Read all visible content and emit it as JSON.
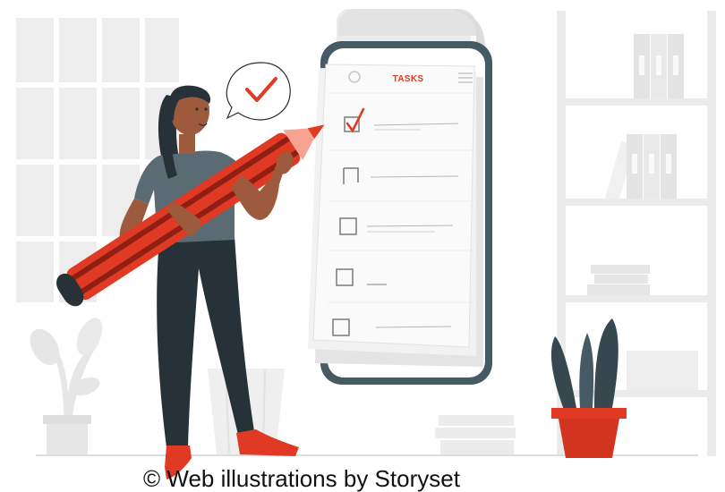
{
  "app": {
    "title": "TASKS",
    "credit": "© Web illustrations by Storyset"
  },
  "checklist": {
    "items": [
      {
        "checked": true
      },
      {
        "checked": false
      },
      {
        "checked": false
      },
      {
        "checked": false
      },
      {
        "checked": false
      }
    ]
  },
  "colors": {
    "accent": "#e03a25",
    "phone_frame": "#455a64",
    "skin": "#9e5a3c",
    "shirt": "#5b6b73",
    "pants": "#263238",
    "hair": "#263238",
    "background_props": "#ebebeb"
  },
  "icons": [
    "check-bubble-icon",
    "hamburger-menu-icon",
    "notepad-ring-icon",
    "checkbox-icon"
  ]
}
